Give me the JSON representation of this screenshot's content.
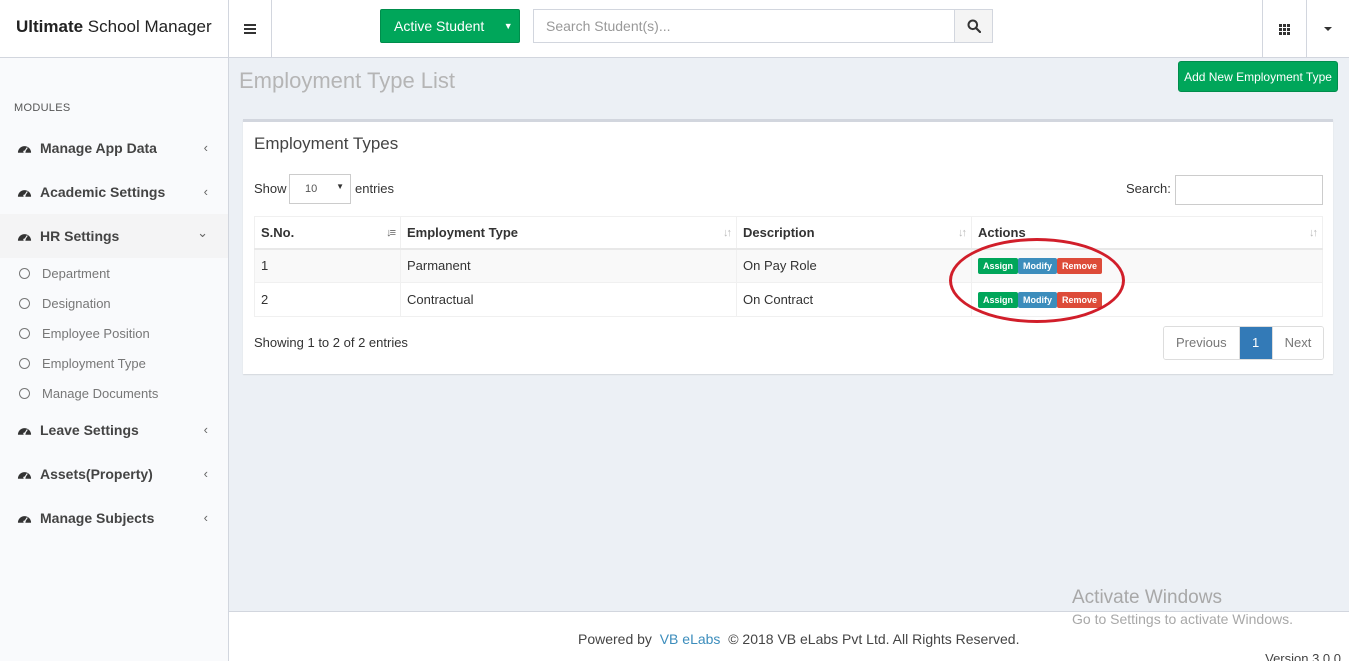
{
  "brand": {
    "bold": "Ultimate",
    "rest": " School Manager"
  },
  "topbar": {
    "active_student_label": "Active Student",
    "search_placeholder": "Search Student(s)..."
  },
  "sidebar": {
    "header": "MODULES",
    "items": [
      {
        "label": "Manage App Data",
        "arrow": "‹"
      },
      {
        "label": "Academic Settings",
        "arrow": "‹"
      },
      {
        "label": "HR Settings",
        "arrow": "⌄"
      },
      {
        "label": "Leave Settings",
        "arrow": "‹"
      },
      {
        "label": "Assets(Property)",
        "arrow": "‹"
      },
      {
        "label": "Manage Subjects",
        "arrow": "‹"
      }
    ],
    "sub_items": [
      {
        "label": "Department"
      },
      {
        "label": "Designation"
      },
      {
        "label": "Employee Position"
      },
      {
        "label": "Employment Type"
      },
      {
        "label": "Manage Documents"
      }
    ]
  },
  "page": {
    "title": "Employment Type List",
    "add_button": "Add New Employment Type"
  },
  "box": {
    "title": "Employment Types",
    "show_label": "Show",
    "entries_value": "10",
    "entries_label": "entries",
    "search_label": "Search:"
  },
  "table": {
    "columns": [
      "S.No.",
      "Employment Type",
      "Description",
      "Actions"
    ],
    "rows": [
      {
        "sno": "1",
        "type": "Parmanent",
        "description": "On Pay Role"
      },
      {
        "sno": "2",
        "type": "Contractual",
        "description": "On Contract"
      }
    ],
    "actions": {
      "assign": "Assign",
      "modify": "Modify",
      "remove": "Remove"
    }
  },
  "pagination": {
    "info": "Showing 1 to 2 of 2 entries",
    "previous": "Previous",
    "current": "1",
    "next": "Next"
  },
  "footer": {
    "powered_by": "Powered by",
    "company_link": "VB eLabs",
    "copyright": "© 2018 VB eLabs Pvt Ltd. All Rights Reserved.",
    "version": "Version 3.0.0"
  },
  "watermark": {
    "line1": "Activate Windows",
    "line2": "Go to Settings to activate Windows."
  },
  "colors": {
    "success": "#00a65a",
    "primary": "#337ab7",
    "info": "#3c8dbc",
    "danger": "#dd4b39",
    "annotation": "#d11e2a",
    "background": "#ecf0f5"
  },
  "icons": [
    "menu-icon",
    "search-icon",
    "apps-grid-icon",
    "dashboard-icon",
    "circle-icon",
    "sort-icon"
  ]
}
